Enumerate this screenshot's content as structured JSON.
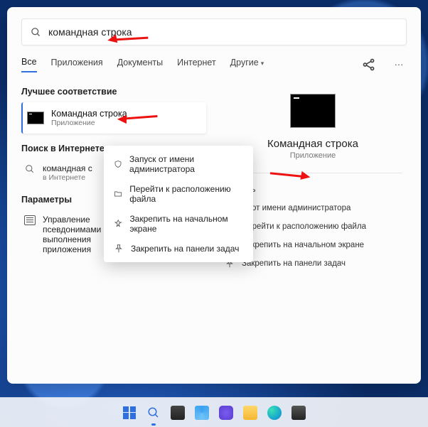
{
  "search": {
    "query": "командная строка"
  },
  "tabs": {
    "all": "Все",
    "apps": "Приложения",
    "docs": "Документы",
    "web": "Интернет",
    "more": "Другие"
  },
  "sections": {
    "best_match": "Лучшее соответствие",
    "web_search": "Поиск в Интернете",
    "settings": "Параметры"
  },
  "best_result": {
    "title": "Командная строка",
    "subtitle": "Приложение"
  },
  "web_result": {
    "title": "командная с",
    "subtitle": "в Интернете"
  },
  "settings_result": {
    "title": "Управление псевдонимами выполнения приложения"
  },
  "context_menu": {
    "run_admin": "Запуск от имени администратора",
    "open_location": "Перейти к расположению файла",
    "pin_start": "Закрепить на начальном экране",
    "pin_taskbar": "Закрепить на панели задач"
  },
  "preview": {
    "title": "Командная строка",
    "subtitle": "Приложение"
  },
  "actions": {
    "open": "ыть",
    "run_admin": "ск от имени администратора",
    "open_location": "Перейти к расположению файла",
    "pin_start": "Закрепить на начальном экране",
    "pin_taskbar": "Закрепить на панели задач"
  }
}
